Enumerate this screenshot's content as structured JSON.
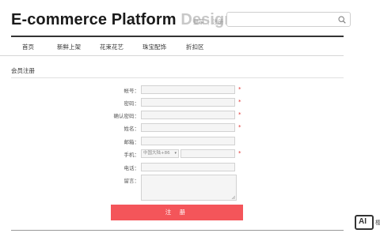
{
  "header": {
    "logo_dark": "E-commerce Platform",
    "logo_light": "Design",
    "login_link": "登录",
    "separator": "|",
    "register_link": "注册",
    "search_placeholder": "",
    "search_icon": "search-icon"
  },
  "nav": {
    "items": [
      {
        "label": "首页"
      },
      {
        "label": "新鲜上架"
      },
      {
        "label": "花束花艺"
      },
      {
        "label": "珠宝配饰"
      },
      {
        "label": "折扣区"
      }
    ]
  },
  "section": {
    "title": "会员注册"
  },
  "form": {
    "account_label": "帐号：",
    "password_label": "密码：",
    "confirm_label": "确认密码：",
    "name_label": "姓名：",
    "email_label": "邮箱：",
    "phone_label": "手机：",
    "tel_label": "电话：",
    "message_label": "留言：",
    "required_mark": "*",
    "country_code": "中国大陆+86",
    "submit_label": "注 册"
  },
  "badge": {
    "text": "AI",
    "side_text": "樱"
  },
  "colors": {
    "accent": "#f4555a",
    "required": "#e0302e",
    "logo_light": "#c8c8c8"
  }
}
